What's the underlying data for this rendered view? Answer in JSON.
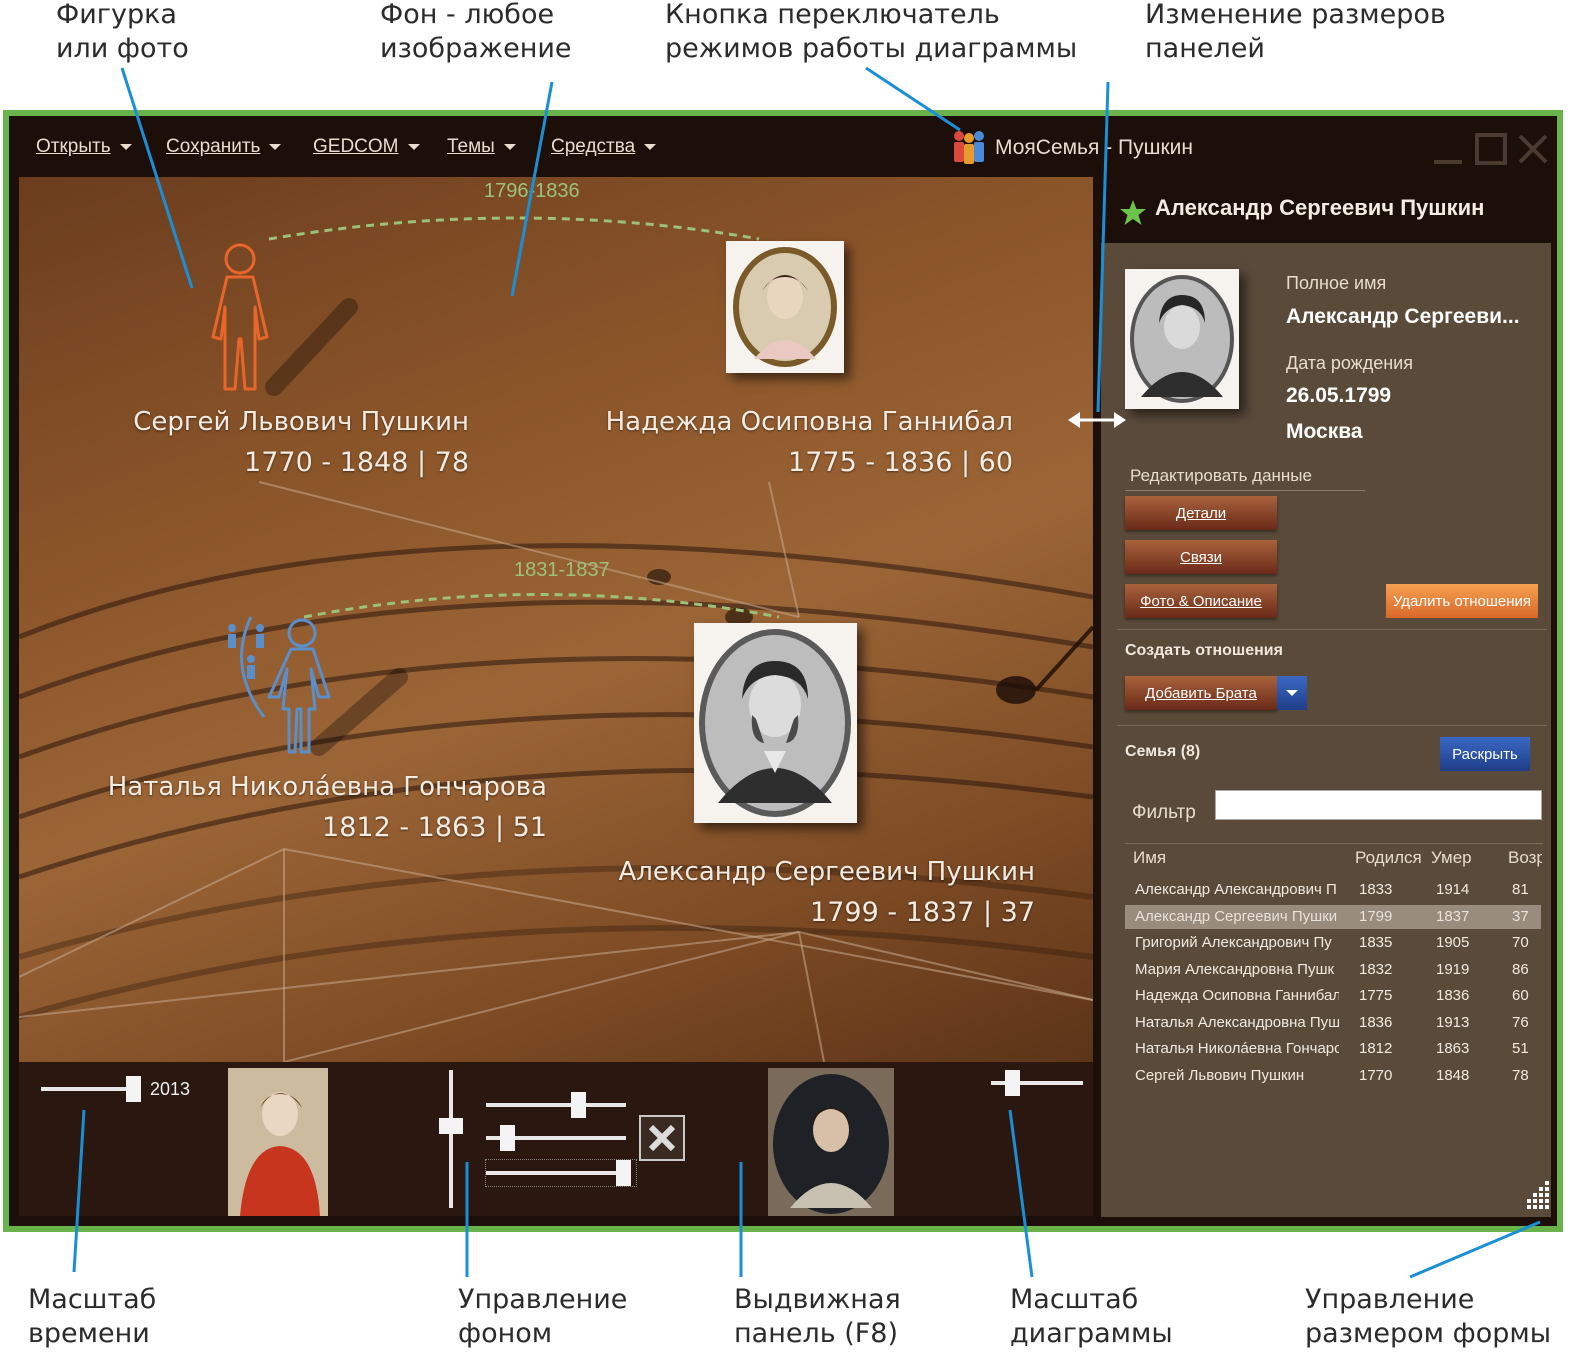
{
  "annotations": {
    "figure_or_photo": "Фигурка\nили фото",
    "background": "Фон - любое\nизображение",
    "mode_switch": "Кнопка переключатель\nрежимов работы диаграммы",
    "panel_resize": "Изменение размеров\nпанелей",
    "time_scale": "Масштаб\nвремени",
    "background_control": "Управление\nфоном",
    "slide_panel": "Выдвижная\nпанель (F8)",
    "diagram_scale": "Масштаб\nдиаграммы",
    "form_size": "Управление\nразмером формы"
  },
  "menu": {
    "open": "Открыть",
    "save": "Сохранить",
    "gedcom": "GEDCOM",
    "themes": "Темы",
    "tools": "Средства"
  },
  "app": {
    "title": "МояСемья - Пушкин"
  },
  "canvas": {
    "marriage1_span": "1796-1836",
    "marriage2_span": "1831-1837",
    "persons": [
      {
        "name": "Сергей Львович Пушкин",
        "dates": "1770 - 1848 | 78"
      },
      {
        "name": "Надежда Осиповна Ганнибал",
        "dates": "1775 - 1836 | 60"
      },
      {
        "name": "Наталья Николáевна Гончарова",
        "dates": "1812 - 1863 | 51"
      },
      {
        "name": "Александр Сергеевич Пушкин",
        "dates": "1799 - 1837 | 37"
      }
    ]
  },
  "bottom": {
    "year": "2013"
  },
  "side": {
    "header_name": "Александр Сергеевич Пушкин",
    "full_name_label": "Полное имя",
    "full_name_value": "Александр Сергееви...",
    "birth_label": "Дата рождения",
    "birth_date": "26.05.1799",
    "birth_place": "Москва",
    "edit_label": "Редактировать данные",
    "btn_details": "Детали",
    "btn_links": "Связи",
    "btn_photo": "Фото & Описание",
    "btn_delete": "Удалить отношения",
    "create_label": "Создать отношения",
    "btn_add": "Добавить Брата",
    "family_label": "Семья (8)",
    "btn_expand": "Раскрыть",
    "filter_label": "Фильтр",
    "filter_value": "",
    "columns": {
      "name": "Имя",
      "born": "Родился",
      "died": "Умер",
      "age": "Возр"
    },
    "rows": [
      {
        "name": "Александр Александрович П",
        "born": "1833",
        "died": "1914",
        "age": "81"
      },
      {
        "name": "Александр Сергеевич Пушки",
        "born": "1799",
        "died": "1837",
        "age": "37"
      },
      {
        "name": "Григорий Александрович Пу",
        "born": "1835",
        "died": "1905",
        "age": "70"
      },
      {
        "name": "Мария Александровна Пушк",
        "born": "1832",
        "died": "1919",
        "age": "86"
      },
      {
        "name": "Надежда Осиповна Ганнибал",
        "born": "1775",
        "died": "1836",
        "age": "60"
      },
      {
        "name": "Наталья Александровна Пуш",
        "born": "1836",
        "died": "1913",
        "age": "76"
      },
      {
        "name": "Наталья Николáевна Гончарс",
        "born": "1812",
        "died": "1863",
        "age": "51"
      },
      {
        "name": "Сергей Львович Пушкин",
        "born": "1770",
        "died": "1848",
        "age": "78"
      }
    ]
  },
  "colors": {
    "frame": "#69b34a",
    "male": "#e8662a",
    "female": "#5b8fc9",
    "callout": "#1b8fd6"
  }
}
